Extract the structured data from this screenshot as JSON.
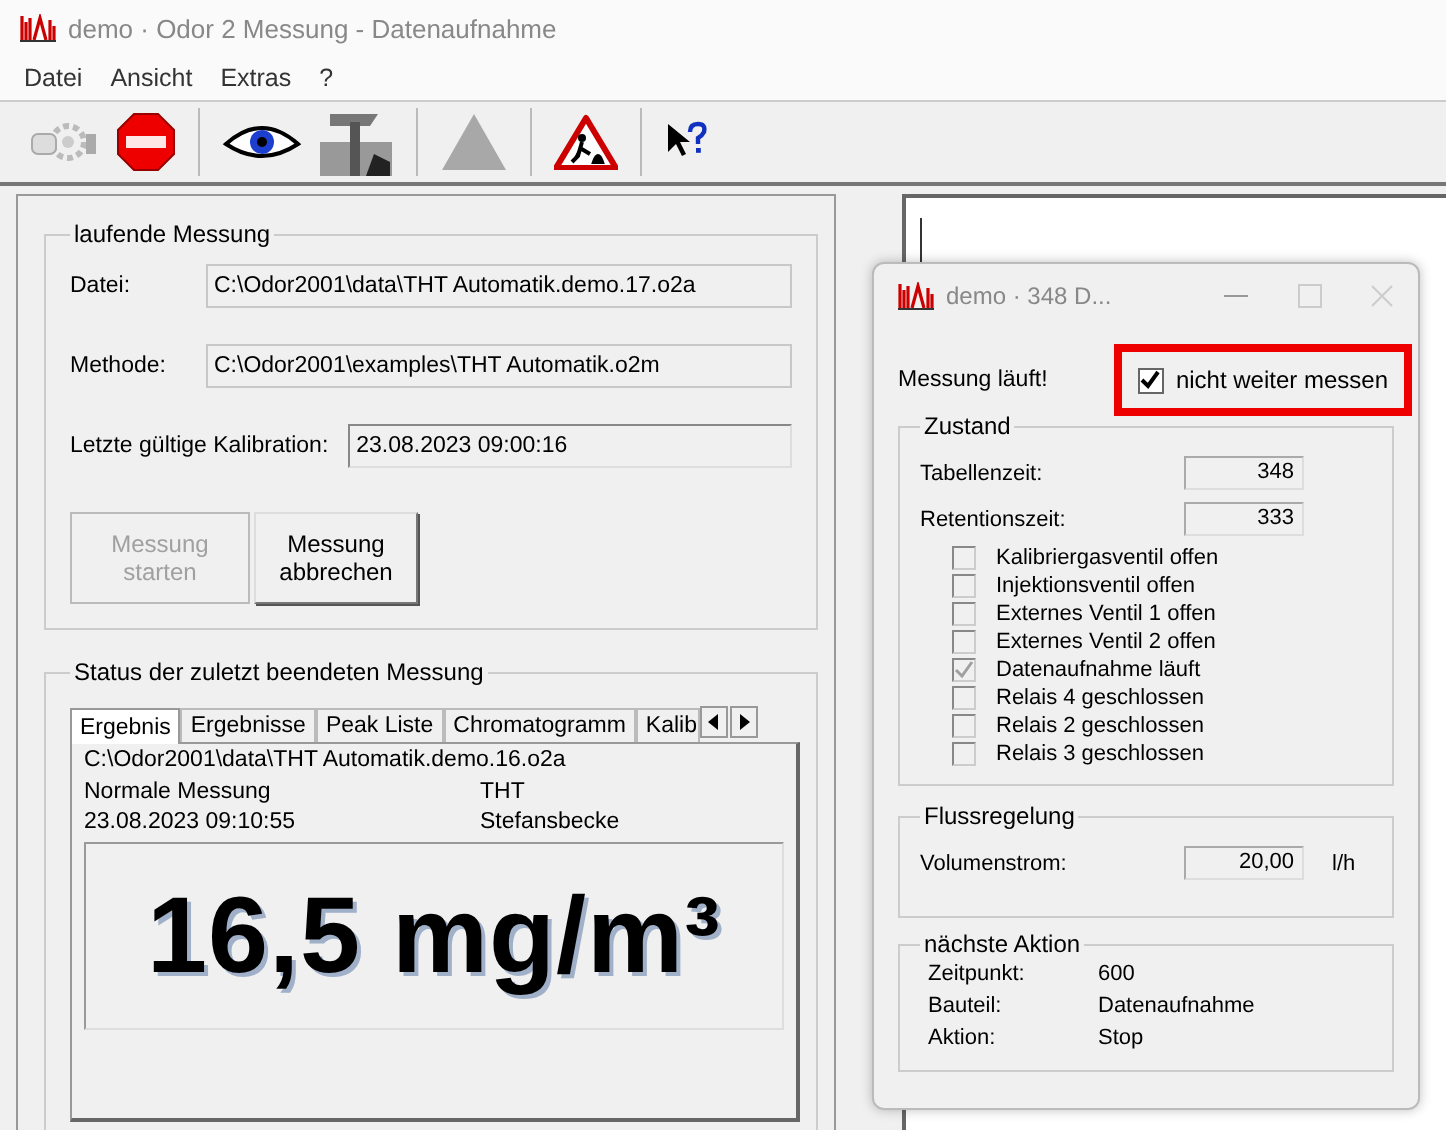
{
  "window": {
    "title": "demo · Odor 2 Messung - Datenaufnahme"
  },
  "menu": [
    "Datei",
    "Ansicht",
    "Extras",
    "?"
  ],
  "current": {
    "title": "laufende Messung",
    "fields": [
      {
        "label": "Datei:",
        "value": "C:\\Odor2001\\data\\THT Automatik.demo.17.o2a"
      },
      {
        "label": "Methode:",
        "value": "C:\\Odor2001\\examples\\THT Automatik.o2m"
      },
      {
        "label": "Letzte gültige Kalibration:",
        "value": "23.08.2023 09:00:16"
      }
    ],
    "buttons": [
      {
        "label": "Messung\nstarten",
        "disabled": true
      },
      {
        "label": "Messung\nabbrechen",
        "disabled": false
      }
    ]
  },
  "last": {
    "title": "Status der zuletzt beendeten Messung",
    "tabs": [
      {
        "label": "Ergebnis",
        "selected": true
      },
      {
        "label": "Ergebnisse",
        "selected": false
      },
      {
        "label": "Peak Liste",
        "selected": false
      },
      {
        "label": "Chromatogramm",
        "selected": false
      },
      {
        "label": "Kalib",
        "selected": false
      }
    ],
    "file": "C:\\Odor2001\\data\\THT Automatik.demo.16.o2a",
    "type": "Normale Messung",
    "substance": "THT",
    "date": "23.08.2023 09:10:55",
    "location": "Stefansbecke",
    "result": "16,5 mg/m³"
  },
  "dialog": {
    "title": "demo · 348 D...",
    "status": "Messung läuft!",
    "stop_checkbox": {
      "label": "nicht weiter messen",
      "checked": true,
      "highlighted": true
    },
    "state": {
      "title": "Zustand",
      "times": [
        {
          "label": "Tabellenzeit:",
          "value": "348"
        },
        {
          "label": "Retentionszeit:",
          "value": "333"
        }
      ],
      "flags": [
        {
          "label": "Kalibriergasventil offen",
          "checked": false
        },
        {
          "label": "Injektionsventil offen",
          "checked": false
        },
        {
          "label": "Externes Ventil 1 offen",
          "checked": false
        },
        {
          "label": "Externes Ventil 2 offen",
          "checked": false
        },
        {
          "label": "Datenaufnahme läuft",
          "checked": true
        },
        {
          "label": "Relais 4 geschlossen",
          "checked": false
        },
        {
          "label": "Relais 2 geschlossen",
          "checked": false
        },
        {
          "label": "Relais 3 geschlossen",
          "checked": false
        }
      ]
    },
    "flow": {
      "title": "Flussregelung",
      "label": "Volumenstrom:",
      "value": "20,00",
      "unit": "l/h"
    },
    "next": {
      "title": "nächste Aktion",
      "rows": [
        {
          "label": "Zeitpunkt:",
          "value": "600"
        },
        {
          "label": "Bauteil:",
          "value": "Datenaufnahme"
        },
        {
          "label": "Aktion:",
          "value": "Stop"
        }
      ]
    }
  }
}
